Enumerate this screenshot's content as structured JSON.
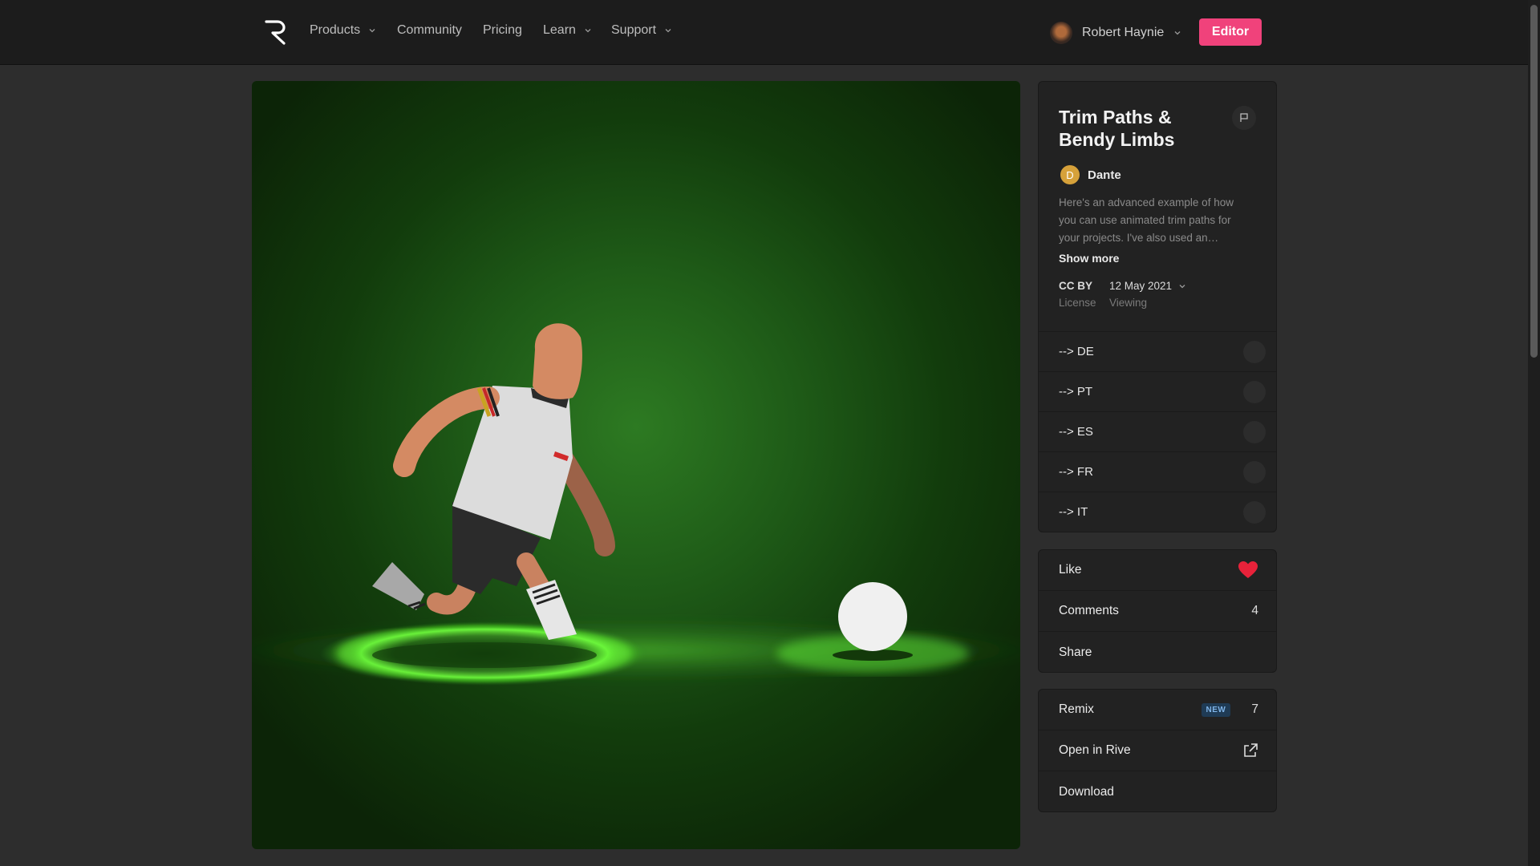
{
  "nav": {
    "items": [
      {
        "label": "Products",
        "dropdown": true
      },
      {
        "label": "Community",
        "dropdown": false
      },
      {
        "label": "Pricing",
        "dropdown": false
      },
      {
        "label": "Learn",
        "dropdown": true
      },
      {
        "label": "Support",
        "dropdown": true
      }
    ],
    "user_name": "Robert Haynie",
    "editor_label": "Editor"
  },
  "post": {
    "title": "Trim Paths & Bendy Limbs",
    "author_initial": "D",
    "author": "Dante",
    "description": "Here's an advanced example of how you can use animated trim paths for your projects. I've also used an…",
    "show_more": "Show more",
    "license_value": "CC BY",
    "license_label": "License",
    "date_value": "12 May 2021",
    "date_label": "Viewing"
  },
  "languages": [
    "--> DE",
    "--> PT",
    "--> ES",
    "--> FR",
    "--> IT"
  ],
  "actions": {
    "like": "Like",
    "comments": "Comments",
    "comments_count": "4",
    "share": "Share"
  },
  "files": {
    "remix": "Remix",
    "remix_badge": "NEW",
    "remix_count": "7",
    "open": "Open in Rive",
    "download": "Download"
  },
  "colors": {
    "accent": "#f0427b",
    "like": "#e8223a",
    "background": "#2d2d2d",
    "nav": "#1c1c1c"
  }
}
